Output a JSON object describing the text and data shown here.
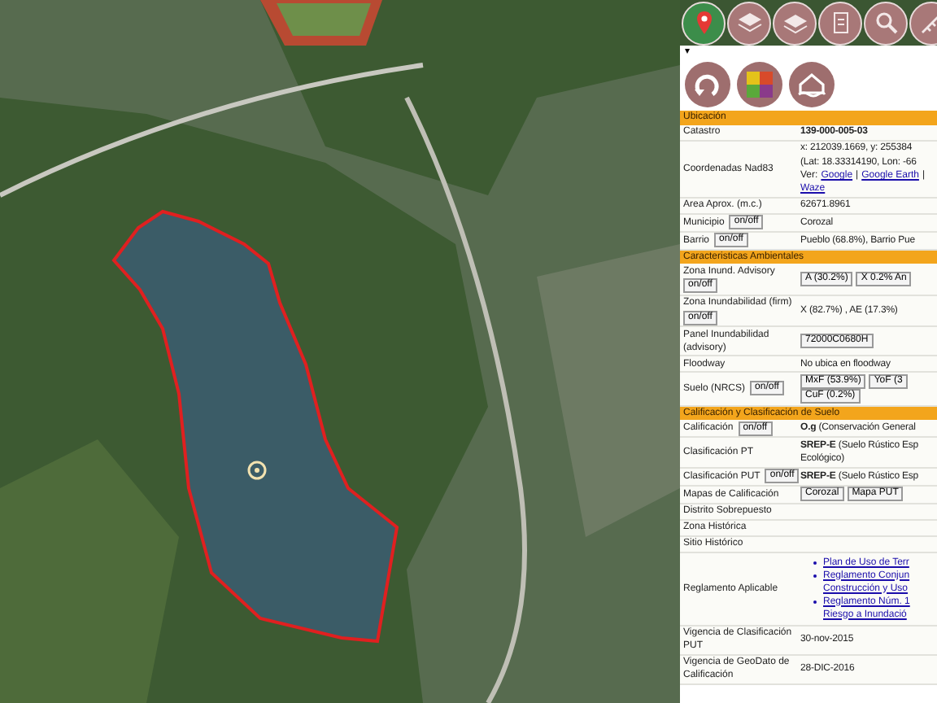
{
  "panel": {
    "caret": "▾",
    "sections": [
      {
        "title": "Ubicación",
        "rows": [
          {
            "label": "Catastro",
            "value": [
              {
                "kind": "bold",
                "text": "139-000-005-03"
              }
            ]
          },
          {
            "label": "Coordenadas Nad83",
            "value": [
              {
                "kind": "text",
                "text": "x: 212039.1669, y: 255384"
              },
              {
                "kind": "text",
                "text": "(Lat: 18.33314190, Lon: -66"
              },
              {
                "kind": "links",
                "prefix": "Ver:",
                "separator": "|",
                "links": [
                  "Google",
                  "Google Earth",
                  "Waze"
                ]
              }
            ]
          },
          {
            "label": "Area Aprox. (m.c.)",
            "value": [
              {
                "kind": "text",
                "text": "62671.8961"
              }
            ]
          },
          {
            "label": "Municipio",
            "toggle": "on/off",
            "value": [
              {
                "kind": "text",
                "text": "Corozal"
              }
            ]
          },
          {
            "label": "Barrio",
            "toggle": "on/off",
            "value": [
              {
                "kind": "text",
                "text": "Pueblo (68.8%), Barrio Pue"
              }
            ]
          }
        ]
      },
      {
        "title": "Caracteristicas Ambientales",
        "rows": [
          {
            "label": "Zona Inund. Advisory",
            "toggle": "on/off",
            "value": [
              {
                "kind": "button",
                "text": "A (30.2%)"
              },
              {
                "kind": "button",
                "text": "X 0.2% An"
              }
            ]
          },
          {
            "label": "Zona Inundabilidad (firm)",
            "toggle": "on/off",
            "value": [
              {
                "kind": "text",
                "text": "X (82.7%) , AE (17.3%)"
              }
            ]
          },
          {
            "label": "Panel Inundabilidad (advisory)",
            "value": [
              {
                "kind": "button",
                "text": "72000C0680H"
              }
            ]
          },
          {
            "label": "Floodway",
            "value": [
              {
                "kind": "text",
                "text": "No ubica en floodway"
              }
            ]
          },
          {
            "label": "Suelo (NRCS)",
            "toggle": "on/off",
            "value": [
              {
                "kind": "button",
                "text": "MxF (53.9%)"
              },
              {
                "kind": "button",
                "text": "YoF (3"
              },
              {
                "kind": "button",
                "text": "CuF (0.2%)"
              }
            ]
          }
        ]
      },
      {
        "title": "Calificación y Clasificación de Suelo",
        "rows": [
          {
            "label": "Calificación",
            "toggle": "on/off",
            "value": [
              {
                "kind": "rich",
                "text": "**O.g** (Conservación General"
              }
            ]
          },
          {
            "label": "Clasificación PT",
            "value": [
              {
                "kind": "rich",
                "text": "**SREP-E** (Suelo Rústico Esp"
              },
              {
                "kind": "text",
                "text": "Ecológico)"
              }
            ]
          },
          {
            "label": "Clasificación PUT",
            "toggle": "on/off",
            "value": [
              {
                "kind": "rich",
                "text": "**SREP-E** (Suelo Rústico Esp"
              }
            ]
          },
          {
            "label": "Mapas de Calificación",
            "value": [
              {
                "kind": "button",
                "text": "Corozal"
              },
              {
                "kind": "button",
                "text": "Mapa PUT"
              }
            ]
          },
          {
            "label": "Distrito Sobrepuesto",
            "value": []
          },
          {
            "label": "Zona Histórica",
            "value": []
          },
          {
            "label": "Sitio Histórico",
            "value": []
          },
          {
            "label": "Reglamento Aplicable",
            "value": [
              {
                "kind": "bullets",
                "items": [
                  {
                    "lines": [
                      "Plan de Uso de Terr"
                    ]
                  },
                  {
                    "lines": [
                      "Reglamento Conjun",
                      "Construcción y Uso"
                    ]
                  },
                  {
                    "lines": [
                      "Reglamento Núm. 1",
                      "Riesgo a Inundació"
                    ]
                  }
                ]
              }
            ]
          },
          {
            "label": "Vigencia de Clasificación PUT",
            "value": [
              {
                "kind": "text",
                "text": "30-nov-2015"
              }
            ]
          },
          {
            "label": "Vigencia de GeoDato de Calificación",
            "value": [
              {
                "kind": "text",
                "text": "28-DIC-2016"
              }
            ]
          }
        ]
      }
    ]
  }
}
